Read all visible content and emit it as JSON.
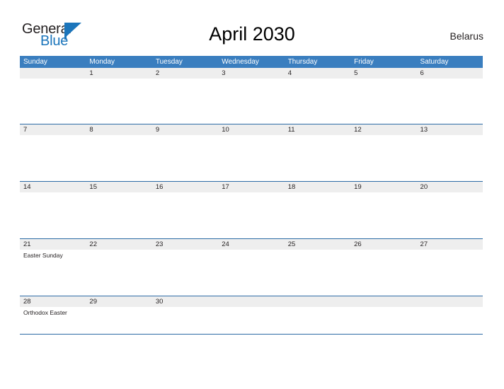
{
  "brand": {
    "name_part1": "General",
    "name_part2": "Blue",
    "flag_icon": "blue-triangle-flag-icon",
    "accent_color": "#1b75bb"
  },
  "header": {
    "title": "April 2030",
    "country": "Belarus"
  },
  "theme": {
    "header_row_color": "#3a7ebf",
    "row_rule_color": "#2c6ba5",
    "band_color": "#eeeeee",
    "text_color": "#231f20"
  },
  "calendar": {
    "month": "April",
    "year": "2030",
    "day_headers": [
      "Sunday",
      "Monday",
      "Tuesday",
      "Wednesday",
      "Thursday",
      "Friday",
      "Saturday"
    ],
    "weeks": [
      {
        "days": [
          {
            "date": "",
            "event": ""
          },
          {
            "date": "1",
            "event": ""
          },
          {
            "date": "2",
            "event": ""
          },
          {
            "date": "3",
            "event": ""
          },
          {
            "date": "4",
            "event": ""
          },
          {
            "date": "5",
            "event": ""
          },
          {
            "date": "6",
            "event": ""
          }
        ]
      },
      {
        "days": [
          {
            "date": "7",
            "event": ""
          },
          {
            "date": "8",
            "event": ""
          },
          {
            "date": "9",
            "event": ""
          },
          {
            "date": "10",
            "event": ""
          },
          {
            "date": "11",
            "event": ""
          },
          {
            "date": "12",
            "event": ""
          },
          {
            "date": "13",
            "event": ""
          }
        ]
      },
      {
        "days": [
          {
            "date": "14",
            "event": ""
          },
          {
            "date": "15",
            "event": ""
          },
          {
            "date": "16",
            "event": ""
          },
          {
            "date": "17",
            "event": ""
          },
          {
            "date": "18",
            "event": ""
          },
          {
            "date": "19",
            "event": ""
          },
          {
            "date": "20",
            "event": ""
          }
        ]
      },
      {
        "days": [
          {
            "date": "21",
            "event": "Easter Sunday"
          },
          {
            "date": "22",
            "event": ""
          },
          {
            "date": "23",
            "event": ""
          },
          {
            "date": "24",
            "event": ""
          },
          {
            "date": "25",
            "event": ""
          },
          {
            "date": "26",
            "event": ""
          },
          {
            "date": "27",
            "event": ""
          }
        ]
      },
      {
        "days": [
          {
            "date": "28",
            "event": "Orthodox Easter"
          },
          {
            "date": "29",
            "event": ""
          },
          {
            "date": "30",
            "event": ""
          },
          {
            "date": "",
            "event": ""
          },
          {
            "date": "",
            "event": ""
          },
          {
            "date": "",
            "event": ""
          },
          {
            "date": "",
            "event": ""
          }
        ]
      }
    ]
  }
}
